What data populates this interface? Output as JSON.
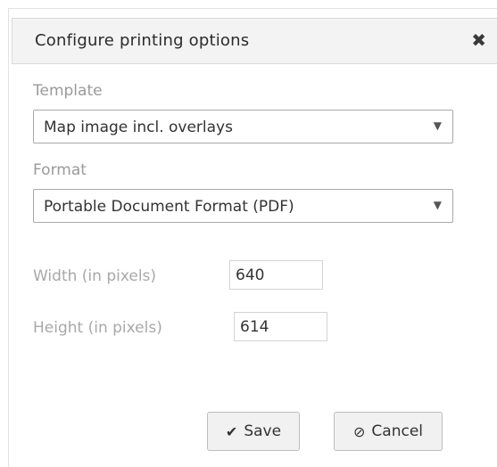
{
  "dialog": {
    "title": "Configure printing options",
    "close_glyph": "✖",
    "close_icon": "close-icon"
  },
  "template": {
    "label": "Template",
    "selected": "Map image incl. overlays"
  },
  "format": {
    "label": "Format",
    "selected": "Portable Document Format (PDF)"
  },
  "width": {
    "label": "Width (in pixels)",
    "value": "640"
  },
  "height": {
    "label": "Height (in pixels)",
    "value": "614"
  },
  "buttons": {
    "save_label": "Save",
    "save_icon": "checkmark-icon",
    "save_glyph": "✔",
    "cancel_label": "Cancel",
    "cancel_icon": "ban-icon",
    "cancel_glyph": "⊘"
  },
  "dropdown_glyph": "▼"
}
